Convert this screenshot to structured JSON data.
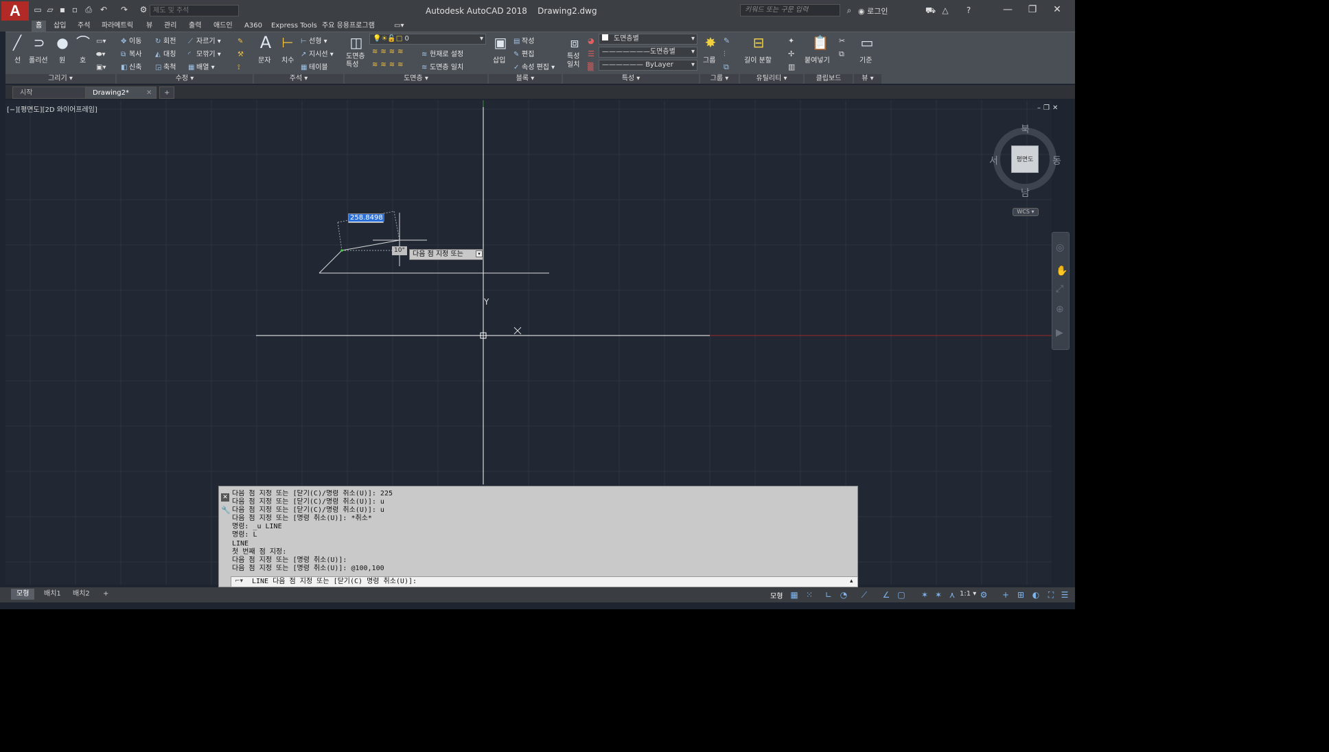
{
  "titlebar": {
    "app_title": "Autodesk AutoCAD 2018    Drawing2.dwg",
    "workspace": "제도 및 주석",
    "search_placeholder": "키워드 또는 구문 입력",
    "login_label": "로그인",
    "logo_text": "A"
  },
  "ribbon_tabs": [
    "홈",
    "삽입",
    "주석",
    "파라메트릭",
    "뷰",
    "관리",
    "출력",
    "애드인",
    "A360",
    "Express Tools",
    "주요 응용프로그램"
  ],
  "ribbon": {
    "draw": {
      "title": "그리기 ▾",
      "line": "선",
      "polyline": "폴리선",
      "circle": "원",
      "arc": "호"
    },
    "modify": {
      "title": "수정 ▾",
      "move": "이동",
      "rotate": "회전",
      "trim": "자르기",
      "copy": "복사",
      "mirror": "대칭",
      "fillet": "모깎기",
      "stretch": "신축",
      "scale": "축척",
      "array": "배열"
    },
    "annotation": {
      "title": "주석 ▾",
      "text": "문자",
      "dimension": "치수",
      "linear": "선형",
      "leader": "지시선",
      "table": "테이블"
    },
    "layers": {
      "title": "도면층 ▾",
      "properties": "도면층\n특성",
      "current_layer": "0",
      "make_current": "현재로 설정",
      "match_layer": "도면층 일치"
    },
    "block": {
      "title": "블록 ▾",
      "insert": "삽입",
      "create": "작성",
      "edit": "편집",
      "edit_attr": "속성 편집"
    },
    "properties": {
      "title": "특성 ▾",
      "match": "특성\n일치",
      "color": "도면층별",
      "linetype": "도면층별",
      "lineweight": "ByLayer"
    },
    "groups": {
      "title": "그룹 ▾",
      "group": "그룹"
    },
    "utilities": {
      "title": "유틸리티 ▾",
      "measure": "길이 분할"
    },
    "clipboard": {
      "title": "클립보드",
      "paste": "붙여넣기"
    },
    "view": {
      "title": "뷰 ▾",
      "base": "기준"
    }
  },
  "doc_tabs": [
    "시작",
    "Drawing2*"
  ],
  "viewport_label": "[−][평면도][2D 와이어프레임]",
  "viewcube": {
    "face": "평면도",
    "north": "북",
    "south": "남",
    "east": "동",
    "west": "서",
    "wcs": "WCS"
  },
  "dynamic_input": {
    "value": "258.8498",
    "angle": "10°",
    "prompt": "다음 점 지정 또는"
  },
  "axis_label_y": "Y",
  "command_history": [
    "다음 점 지정 또는 [닫기(C)/명령 취소(U)]: 225",
    "다음 점 지정 또는 [닫기(C)/명령 취소(U)]: u",
    "다음 점 지정 또는 [닫기(C)/명령 취소(U)]: u",
    "다음 점 지정 또는 [명령 취소(U)]: *취소*",
    "명령: _u LINE",
    "명령: L",
    "LINE",
    "첫 번째 점 지정:",
    "다음 점 지정 또는 [명령 취소(U)]:",
    "다음 점 지정 또는 [명령 취소(U)]: @100,100"
  ],
  "command_input": "LINE 다음 점 지정 또는 [닫기(C) 명령 취소(U)]:",
  "layout_tabs": [
    "모형",
    "배치1",
    "배치2"
  ],
  "status": {
    "model": "모형",
    "scale": "1:1"
  }
}
